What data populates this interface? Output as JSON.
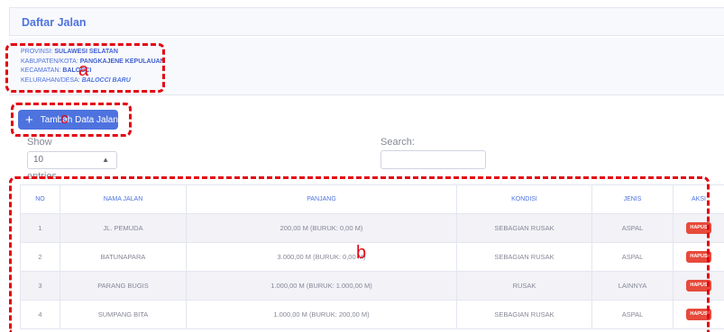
{
  "header": {
    "title": "Daftar Jalan"
  },
  "location": {
    "provinsi_label": "PROVINSI:",
    "provinsi_value": "SULAWESI SELATAN",
    "kabupaten_label": "KABUPATEN/KOTA:",
    "kabupaten_value": "PANGKAJENE KEPULAUAN",
    "kecamatan_label": "KECAMATAN:",
    "kecamatan_value": "BALOCCI",
    "kelurahan_label": "KELURAHAN/DESA:",
    "kelurahan_value": "BALOCCI BARU"
  },
  "toolbar": {
    "add_label": "Tambah Data Jalan",
    "add_icon": "plus-icon"
  },
  "length_menu": {
    "show_label": "Show",
    "value": "10",
    "entries_label": "entries"
  },
  "search": {
    "label": "Search:",
    "value": ""
  },
  "table": {
    "headers": [
      "NO",
      "NAMA JALAN",
      "PANJANG",
      "KONDISI",
      "JENIS",
      "AKSI"
    ],
    "rows": [
      {
        "no": "1",
        "nama": "JL. PEMUDA",
        "panjang": "200,00 M (BURUK: 0,00 M)",
        "kondisi": "SEBAGIAN RUSAK",
        "jenis": "ASPAL",
        "aksi": "HAPUS"
      },
      {
        "no": "2",
        "nama": "BATUNAPARA",
        "panjang": "3.000,00 M (BURUK: 0,00 M)",
        "kondisi": "SEBAGIAN RUSAK",
        "jenis": "ASPAL",
        "aksi": "HAPUS"
      },
      {
        "no": "3",
        "nama": "PARANG BUGIS",
        "panjang": "1.000,00 M (BURUK: 1.000,00 M)",
        "kondisi": "RUSAK",
        "jenis": "LAINNYA",
        "aksi": "HAPUS"
      },
      {
        "no": "4",
        "nama": "SUMPANG BITA",
        "panjang": "1.000,00 M (BURUK: 200,00 M)",
        "kondisi": "SEBAGIAN RUSAK",
        "jenis": "ASPAL",
        "aksi": "HAPUS"
      }
    ]
  },
  "annotations": {
    "a": "a",
    "c": "c",
    "b": "b",
    "color": "#e30613"
  },
  "colors": {
    "primary": "#4e73df",
    "danger": "#e74a3b"
  }
}
